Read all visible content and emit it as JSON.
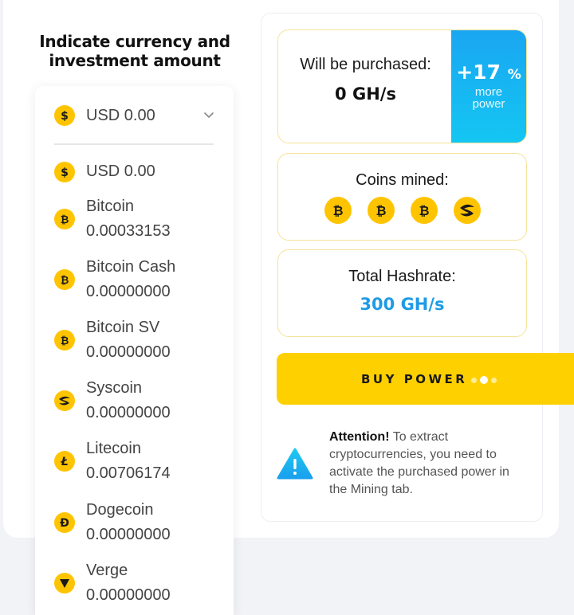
{
  "heading": "Indicate currency and investment amount",
  "currency_dropdown": {
    "selected": "USD 0.00",
    "options": [
      {
        "name": "USD 0.00",
        "value": "",
        "icon": "dollar-icon"
      },
      {
        "name": "Bitcoin",
        "value": "0.00033153",
        "icon": "bitcoin-icon"
      },
      {
        "name": "Bitcoin Cash",
        "value": "0.00000000",
        "icon": "bitcoin-cash-icon"
      },
      {
        "name": "Bitcoin SV",
        "value": "0.00000000",
        "icon": "bitcoin-sv-icon"
      },
      {
        "name": "Syscoin",
        "value": "0.00000000",
        "icon": "syscoin-icon"
      },
      {
        "name": "Litecoin",
        "value": "0.00706174",
        "icon": "litecoin-icon"
      },
      {
        "name": "Dogecoin",
        "value": "0.00000000",
        "icon": "dogecoin-icon"
      },
      {
        "name": "Verge",
        "value": "0.00000000",
        "icon": "verge-icon"
      }
    ]
  },
  "purchase": {
    "label": "Will be purchased:",
    "value": "0 GH/s",
    "bonus": "+17",
    "bonus_unit": "%",
    "bonus_text_1": "more",
    "bonus_text_2": "power"
  },
  "mined": {
    "label": "Coins mined:",
    "coins": [
      "bitcoin-icon",
      "bitcoin-icon",
      "bitcoin-icon",
      "syscoin-icon"
    ]
  },
  "hashrate": {
    "label": "Total Hashrate:",
    "value": "300 GH/s"
  },
  "buy_button": {
    "label": "BUY POWER"
  },
  "attention": {
    "title": "Attention!",
    "text": "To extract cryptocurrencies, you need to activate the purchased power in the Mining tab."
  },
  "colors": {
    "accent_yellow": "#ffd000",
    "coin_yellow": "#ffc400",
    "blue": "#1e9be6",
    "bonus_gradient_top": "#1aa6f2",
    "bonus_gradient_bottom": "#14c6f2"
  }
}
